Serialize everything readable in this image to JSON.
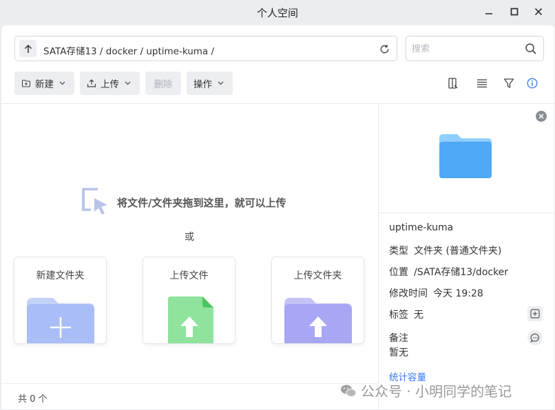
{
  "window": {
    "title": "个人空间",
    "controls": {
      "minimize": "–",
      "maximize": "☐",
      "close": "✕"
    }
  },
  "pathbar": {
    "path": "SATA存储13 / docker / uptime-kuma /"
  },
  "search": {
    "placeholder": "搜索"
  },
  "toolbar": {
    "new_label": "新建",
    "upload_label": "上传",
    "delete_label": "删除",
    "operations_label": "操作",
    "view_icons": [
      "columns-icon",
      "list-icon",
      "filter-icon",
      "info-icon"
    ]
  },
  "dropzone": {
    "hint": "将文件/文件夹拖到这里，就可以上传",
    "or": "或",
    "cards": [
      {
        "label": "新建文件夹"
      },
      {
        "label": "上传文件"
      },
      {
        "label": "上传文件夹"
      }
    ]
  },
  "status": {
    "count_text": "共 0 个"
  },
  "details": {
    "name": "uptime-kuma",
    "type_key": "类型",
    "type_value": "文件夹 (普通文件夹)",
    "location_key": "位置",
    "location_value": "/SATA存储13/docker",
    "mtime_key": "修改时间",
    "mtime_value": "今天 19:28",
    "tags_key": "标签",
    "tags_value": "无",
    "note_key": "备注",
    "note_value": "暂无",
    "stats_link": "统计容量"
  },
  "watermark": {
    "text": "公众号 · 小明同学的笔记"
  },
  "colors": {
    "accent": "#3478f6",
    "folder_blue": "#5ab3ff",
    "file_green": "#5fd07a",
    "folder_purple": "#a7a8f5"
  }
}
